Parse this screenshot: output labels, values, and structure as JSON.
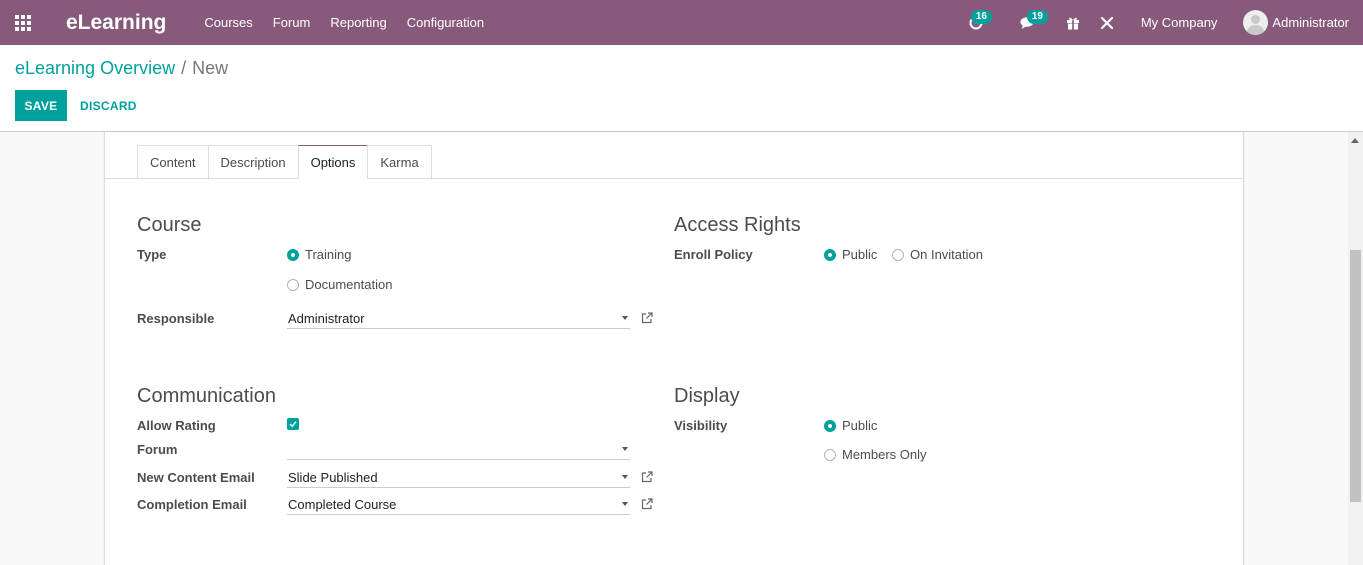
{
  "app": {
    "brand": "eLearning",
    "menu": [
      "Courses",
      "Forum",
      "Reporting",
      "Configuration"
    ],
    "activity_count": "16",
    "message_count": "19",
    "company": "My Company",
    "user": "Administrator"
  },
  "breadcrumb": {
    "parent": "eLearning Overview",
    "separator": "/",
    "current": "New"
  },
  "buttons": {
    "save": "SAVE",
    "discard": "DISCARD"
  },
  "tabs": [
    {
      "label": "Content",
      "active": false
    },
    {
      "label": "Description",
      "active": false
    },
    {
      "label": "Options",
      "active": true
    },
    {
      "label": "Karma",
      "active": false
    }
  ],
  "course": {
    "title": "Course",
    "type_label": "Type",
    "type_options": [
      {
        "label": "Training",
        "checked": true
      },
      {
        "label": "Documentation",
        "checked": false
      }
    ],
    "responsible_label": "Responsible",
    "responsible_value": "Administrator"
  },
  "access_rights": {
    "title": "Access Rights",
    "enroll_label": "Enroll Policy",
    "enroll_options": [
      {
        "label": "Public",
        "checked": true
      },
      {
        "label": "On Invitation",
        "checked": false
      }
    ]
  },
  "communication": {
    "title": "Communication",
    "allow_rating_label": "Allow Rating",
    "allow_rating_checked": true,
    "forum_label": "Forum",
    "forum_value": "",
    "new_content_email_label": "New Content Email",
    "new_content_email_value": "Slide Published",
    "completion_email_label": "Completion Email",
    "completion_email_value": "Completed Course"
  },
  "display": {
    "title": "Display",
    "visibility_label": "Visibility",
    "visibility_options": [
      {
        "label": "Public",
        "checked": true
      },
      {
        "label": "Members Only",
        "checked": false
      }
    ]
  },
  "colors": {
    "navbar": "#875a7b",
    "accent": "#00a09d"
  }
}
